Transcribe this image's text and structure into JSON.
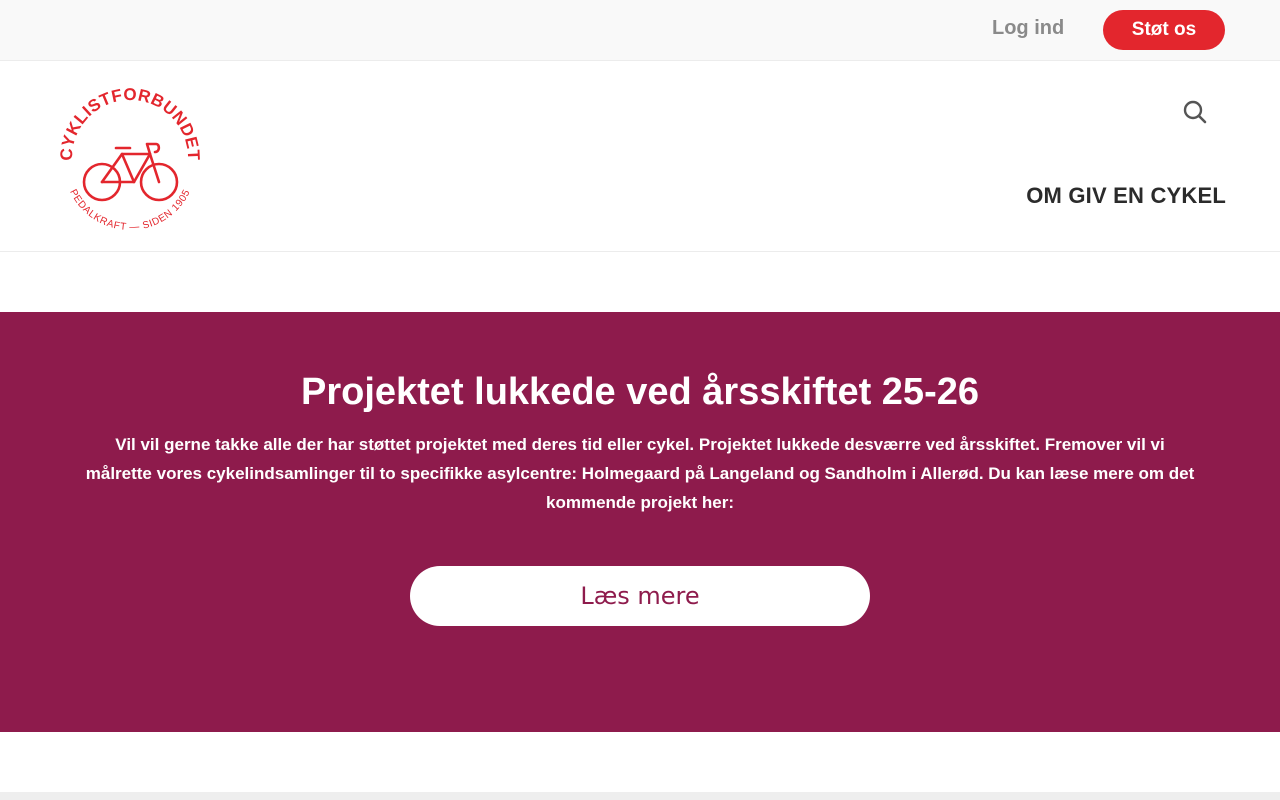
{
  "topbar": {
    "login_label": "Log ind",
    "support_label": "Støt os"
  },
  "logo": {
    "name": "CYKLISTFORBUNDET",
    "tagline": "PEDALKRAFT — SIDEN 1905",
    "icon": "bicycle-icon",
    "color": "#e3262d"
  },
  "header": {
    "search_icon": "search-icon",
    "nav_label": "OM GIV EN CYKEL"
  },
  "banner": {
    "title": "Projektet lukkede ved årsskiftet 25-26",
    "text": "Vil vil gerne takke alle der har støttet projektet med deres tid eller cykel. Projektet lukkede desværre ved årsskiftet. Fremover vil vi målrette vores cykelindsamlinger til to specifikke asylcentre: Holmegaard på Langeland og Sandholm i Allerød. Du kan læse mere om det kommende projekt her:",
    "button_label": "Læs mere",
    "background_color": "#8e1b4c"
  }
}
